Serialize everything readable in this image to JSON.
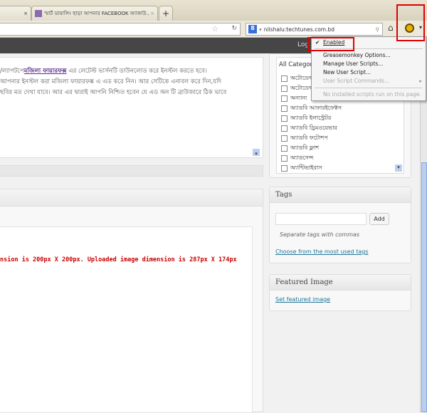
{
  "tabs": [
    {
      "label": "",
      "close": "×"
    },
    {
      "label": "স্মার্ট ডায়ালিং ছাড়া আপনার FACEBOOK অ্যাকাউ...",
      "close": "×"
    }
  ],
  "new_tab": "+",
  "search": {
    "engine": "8",
    "value": "nilshalu:techtunes.com.bd"
  },
  "adminbar": {
    "logout": "Log"
  },
  "editor": {
    "line1_pre": "/ল্যাপটপে",
    "link": "মজিলা ফায়ারফক্স",
    "line1_post": " এর লেটেস্ট ভার্সনটি ডাউনলোড করে ইনস্টল করতে হবে।",
    "line2": "আপনার ইনস্টল করা মজিলা ফায়ারফক্স এ এড করে নিন। আর সেটিকে এনাবল করে দিন,যদি",
    "line3": "ছবির মত দেখা যাবে। আর এর দ্বারাই আপনি নিশ্চিত হবেন যে এড অন টি ব্রাউজারে ঠিক ভাবে"
  },
  "error": "nsion is 200px X 200px. Uploaded image dimension is 287px X 174px",
  "categories": {
    "tab": "All Categories",
    "items": [
      "অটোডেস্ক",
      "অটোডেস্ক",
      "অন্যান্য",
      "অ্যাডবি আফারইফেক্টস",
      "অ্যাডবি ইলাস্ট্রেটর",
      "অ্যাডবি ড্রিমওয়েভার",
      "অ্যাডবি ফটোশপ",
      "অ্যাডবি ফ্লাশ",
      "অ্যাডসেন্স",
      "অ্যান্টিভাইরাস"
    ]
  },
  "tags": {
    "title": "Tags",
    "add": "Add",
    "hint": "Separate tags with commas",
    "choose": "Choose from the most used tags"
  },
  "featured": {
    "title": "Featured Image",
    "set": "Set featured image"
  },
  "menu": {
    "enabled": "Enabled",
    "options": "Greasemonkey Options...",
    "manage": "Manage User Scripts...",
    "new": "New User Script...",
    "commands": "User Script Commands...",
    "none": "No installed scripts run on this page."
  }
}
